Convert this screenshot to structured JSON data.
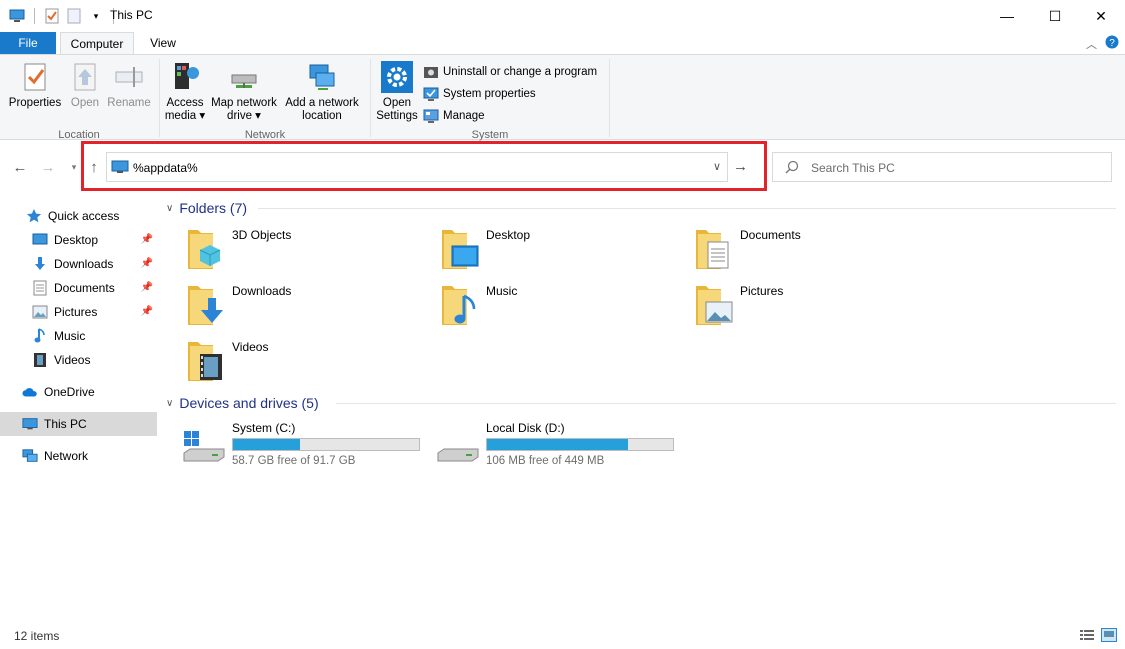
{
  "window": {
    "title": "This PC",
    "minimize": "—",
    "maximize": "☐",
    "close": "✕"
  },
  "tabs": {
    "file": "File",
    "computer": "Computer",
    "view": "View"
  },
  "ribbon": {
    "location": {
      "label": "Location",
      "properties": "Properties",
      "open": "Open",
      "rename": "Rename"
    },
    "network": {
      "label": "Network",
      "access_media": "Access media ▾",
      "map_drive": "Map network drive ▾",
      "add_location": "Add a network location"
    },
    "system": {
      "label": "System",
      "open_settings": "Open Settings",
      "uninstall": "Uninstall or change a program",
      "sys_props": "System properties",
      "manage": "Manage"
    }
  },
  "address": {
    "value": "%appdata%"
  },
  "search": {
    "placeholder": "Search This PC"
  },
  "nav": {
    "quick_access": "Quick access",
    "items": [
      "Desktop",
      "Downloads",
      "Documents",
      "Pictures",
      "Music",
      "Videos"
    ],
    "onedrive": "OneDrive",
    "this_pc": "This PC",
    "network": "Network"
  },
  "folders": {
    "header": "Folders (7)",
    "items": [
      "3D Objects",
      "Desktop",
      "Documents",
      "Downloads",
      "Music",
      "Pictures",
      "Videos"
    ]
  },
  "drives": {
    "header": "Devices and drives (5)",
    "items": [
      {
        "name": "System (C:)",
        "free": "58.7 GB free of 91.7 GB",
        "used_fraction": 0.36
      },
      {
        "name": "Local Disk (D:)",
        "free": "106 MB free of 449 MB",
        "used_fraction": 0.76
      }
    ]
  },
  "status": {
    "count": "12 items"
  },
  "colors": {
    "accent": "#1979ca",
    "highlight": "#e3232b",
    "folder": "#f3cd5c",
    "bar": "#26a0da"
  }
}
